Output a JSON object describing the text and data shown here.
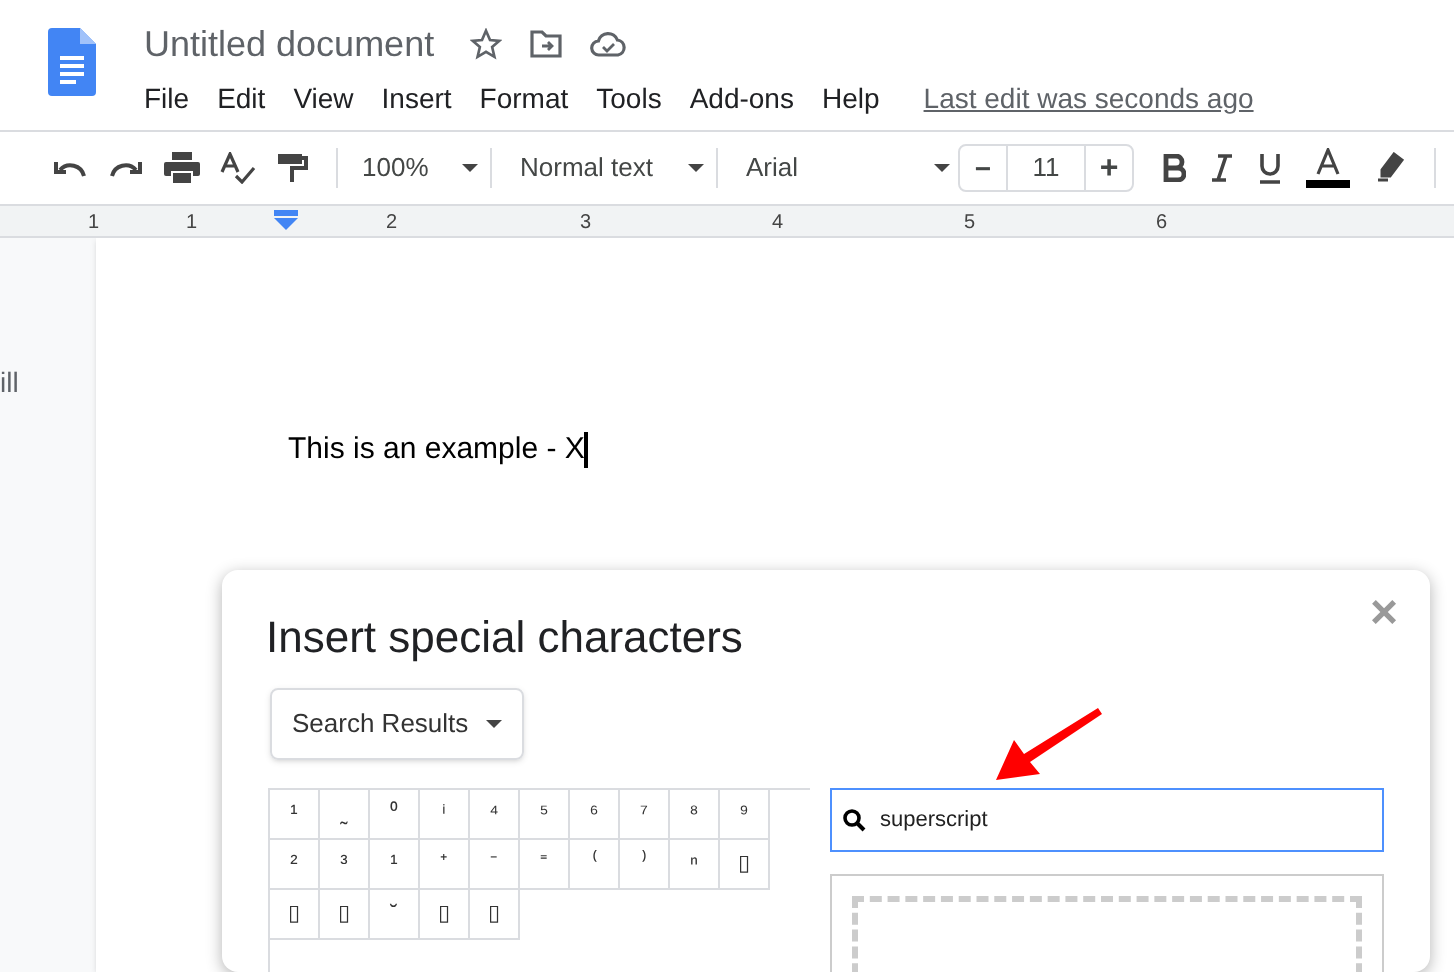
{
  "document": {
    "title": "Untitled document",
    "last_edit": "Last edit was seconds ago"
  },
  "menu": [
    "File",
    "Edit",
    "View",
    "Insert",
    "Format",
    "Tools",
    "Add-ons",
    "Help"
  ],
  "toolbar": {
    "zoom": "100%",
    "style": "Normal text",
    "font": "Arial",
    "font_size": "11",
    "minus": "−",
    "plus": "+"
  },
  "ruler": [
    "1",
    "1",
    "2",
    "3",
    "4",
    "5",
    "6"
  ],
  "side_text": "ill",
  "body_text": "This is an example - X",
  "dialog": {
    "title": "Insert special characters",
    "category": "Search Results",
    "close": "×",
    "characters": [
      "¹",
      "˷",
      "⁰",
      "ⁱ",
      "⁴",
      "⁵",
      "⁶",
      "⁷",
      "⁸",
      "⁹",
      "²",
      "³",
      "¹",
      "⁺",
      "⁻",
      "⁼",
      "⁽",
      "⁾",
      "ⁿ",
      "▯",
      "▯",
      "▯",
      "˘",
      "▯",
      "▯"
    ],
    "search": {
      "value": "superscript"
    }
  }
}
